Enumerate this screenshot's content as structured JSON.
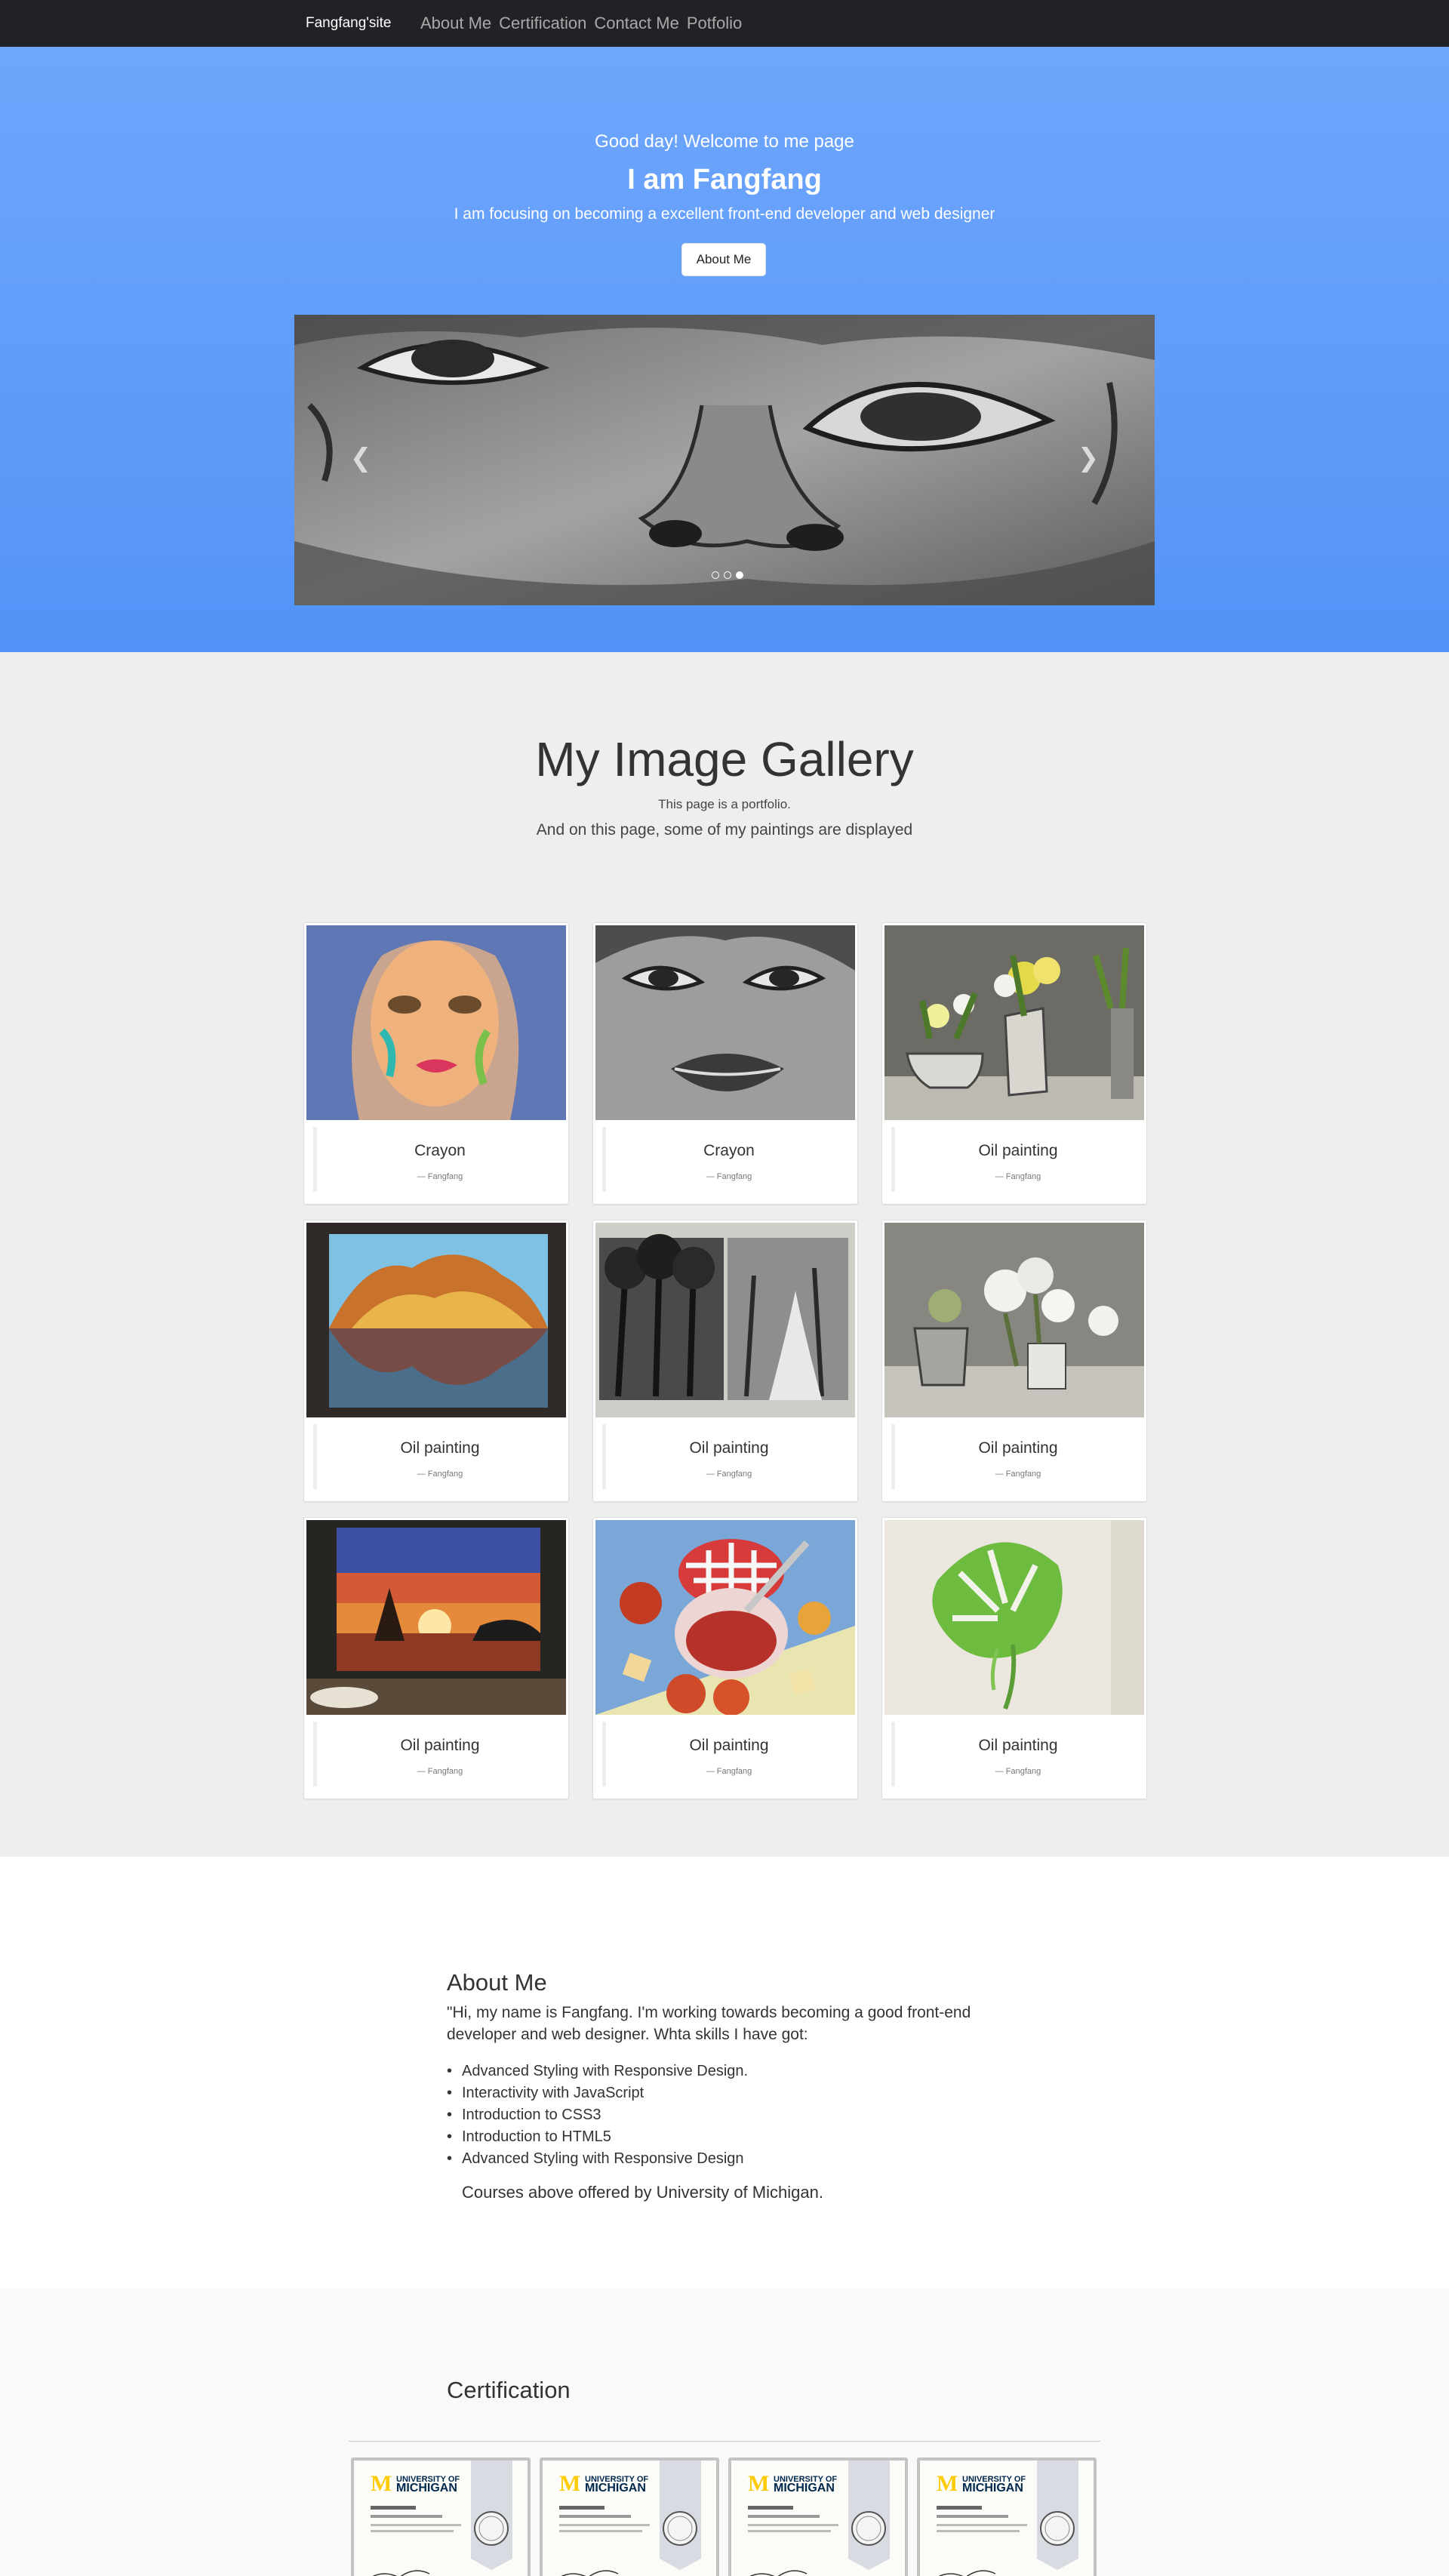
{
  "navbar": {
    "brand": "Fangfang'site",
    "links": [
      "About Me",
      "Certification",
      "Contact Me",
      "Potfolio"
    ]
  },
  "hero": {
    "greeting": "Good day! Welcome to me page",
    "title": "I am Fangfang",
    "subtitle": "I am focusing on becoming a excellent front-end developer and web designer",
    "button": "About Me",
    "carousel": {
      "prev_icon": "chevron-left-icon",
      "next_icon": "chevron-right-icon",
      "slide_count": 3,
      "active_slide": 3
    }
  },
  "gallery": {
    "title": "My Image Gallery",
    "subtitle": "This page is a portfolio.",
    "lead": "And on this page, some of my paintings are displayed",
    "items": [
      {
        "caption": "Crayon",
        "author": "— Fangfang"
      },
      {
        "caption": "Crayon",
        "author": "— Fangfang"
      },
      {
        "caption": "Oil painting",
        "author": "— Fangfang"
      },
      {
        "caption": "Oil painting",
        "author": "— Fangfang"
      },
      {
        "caption": "Oil painting",
        "author": "— Fangfang"
      },
      {
        "caption": "Oil painting",
        "author": "— Fangfang"
      },
      {
        "caption": "Oil painting",
        "author": "— Fangfang"
      },
      {
        "caption": "Oil painting",
        "author": "— Fangfang"
      },
      {
        "caption": "Oil painting",
        "author": "— Fangfang"
      }
    ]
  },
  "about": {
    "title": "About Me",
    "intro": "\"Hi, my name is Fangfang. I'm working towards becoming a good front-end developer and web designer. Whta skills I have got:",
    "skills": [
      "Advanced Styling with Responsive Design.",
      "Interactivity with JavaScript",
      "Introduction to CSS3",
      "Introduction to HTML5",
      "Advanced Styling with Responsive Design"
    ],
    "note": "Courses above offered by University of Michigan."
  },
  "certification": {
    "title": "Certification",
    "certificates": [
      {
        "logo_letter": "M",
        "issuer_line1": "UNIVERSITY OF",
        "issuer_line2": "MICHIGAN"
      },
      {
        "logo_letter": "M",
        "issuer_line1": "UNIVERSITY OF",
        "issuer_line2": "MICHIGAN"
      },
      {
        "logo_letter": "M",
        "issuer_line1": "UNIVERSITY OF",
        "issuer_line2": "MICHIGAN"
      },
      {
        "logo_letter": "M",
        "issuer_line1": "UNIVERSITY OF",
        "issuer_line2": "MICHIGAN"
      }
    ]
  },
  "colors": {
    "navbar": "#202226",
    "hero_top": "#6ea6fc",
    "hero_bottom": "#5393f7",
    "gallery_bg": "#eeeeee",
    "cert_bg": "#f8f9fa",
    "michigan_blue": "#00274c",
    "michigan_maize": "#ffcb05"
  }
}
